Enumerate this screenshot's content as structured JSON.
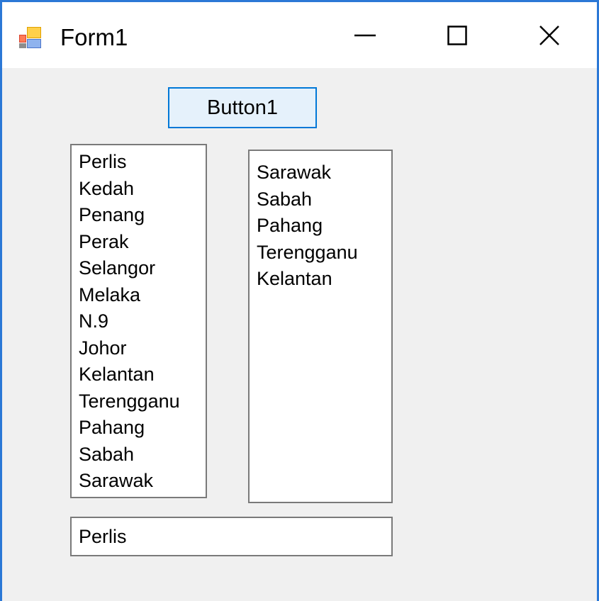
{
  "window": {
    "title": "Form1",
    "accent_color": "#2b78d6",
    "controls": {
      "minimize_icon": "minimize-icon",
      "maximize_icon": "maximize-icon",
      "close_icon": "close-icon"
    }
  },
  "button1": {
    "label": "Button1"
  },
  "listbox1": {
    "items": [
      "Perlis",
      "Kedah",
      "Penang",
      "Perak",
      "Selangor",
      "Melaka",
      "N.9",
      "Johor",
      "Kelantan",
      "Terengganu",
      "Pahang",
      "Sabah",
      "Sarawak"
    ]
  },
  "listbox2": {
    "items": [
      "Sarawak",
      "Sabah",
      "Pahang",
      "Terengganu",
      "Kelantan"
    ]
  },
  "textbox1": {
    "value": "Perlis"
  }
}
